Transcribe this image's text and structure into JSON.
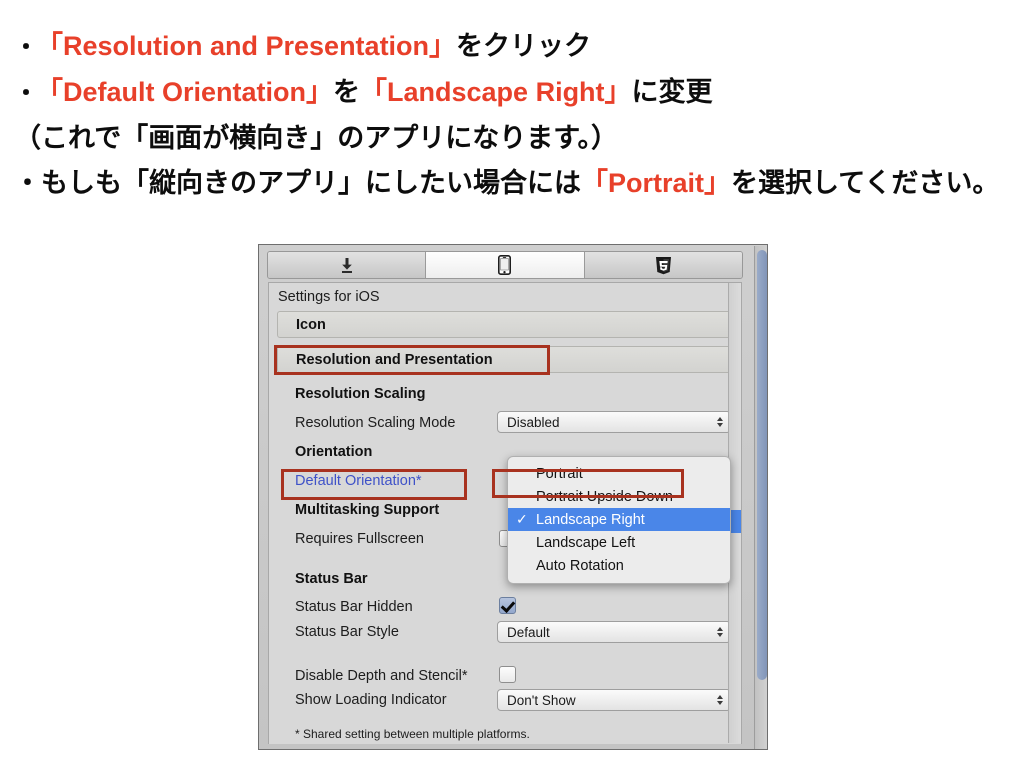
{
  "instructions": {
    "line1": {
      "bullet": "・",
      "red": "「Resolution and Presentation」",
      "black": "をクリック"
    },
    "line2": {
      "bullet": "・",
      "red1": "「Default Orientation」",
      "mid": "を",
      "red2": "「Landscape Right」",
      "black": "に変更"
    },
    "line3": {
      "text": "（これで「画面が横向き」のアプリになります。）"
    },
    "line4": {
      "pre": "・もしも「縦向きのアプリ」にしたい場合には",
      "red": "「Portrait」",
      "post": "を選択してください。"
    }
  },
  "screenshot": {
    "tabs": [
      {
        "name": "install-tab",
        "icon": "download-icon",
        "active": false
      },
      {
        "name": "mobile-tab",
        "icon": "mobile-device-icon",
        "active": true
      },
      {
        "name": "html5-tab",
        "icon": "html5-icon",
        "active": false
      }
    ],
    "pane_title": "Settings for iOS",
    "groups": [
      {
        "label": "Icon",
        "highlighted": false
      },
      {
        "label": "Resolution and Presentation",
        "highlighted": true
      }
    ],
    "sections": {
      "resolution_scaling": "Resolution Scaling",
      "orientation": "Orientation",
      "multitasking": "Multitasking Support",
      "status_bar": "Status Bar"
    },
    "rows": {
      "resolution_scaling_mode": {
        "label": "Resolution Scaling Mode",
        "value": "Disabled"
      },
      "default_orientation": {
        "label": "Default Orientation*",
        "value": "Landscape Right",
        "highlighted": true
      },
      "requires_fullscreen": {
        "label": "Requires Fullscreen",
        "checked": false
      },
      "status_bar_hidden": {
        "label": "Status Bar Hidden",
        "checked": true
      },
      "status_bar_style": {
        "label": "Status Bar Style",
        "value": "Default"
      },
      "disable_depth_stencil": {
        "label": "Disable Depth and Stencil*",
        "checked": false
      },
      "show_loading_indicator": {
        "label": "Show Loading Indicator",
        "value": "Don't Show"
      }
    },
    "dropdown": {
      "open": true,
      "items": [
        {
          "label": "Portrait",
          "selected": false,
          "check": ""
        },
        {
          "label": "Portrait Upside Down",
          "selected": false,
          "check": ""
        },
        {
          "label": "Landscape Right",
          "selected": true,
          "check": "✓"
        },
        {
          "label": "Landscape Left",
          "selected": false,
          "check": ""
        },
        {
          "label": "Auto Rotation",
          "selected": false,
          "check": ""
        }
      ]
    },
    "footnote": "* Shared setting between multiple platforms."
  },
  "colors": {
    "accent_red": "#e8402a",
    "annotation_red": "#a8321f",
    "link_blue": "#3f52c8",
    "selection_blue": "#4a86e8",
    "scrollbar_blue": "#8195b8"
  }
}
